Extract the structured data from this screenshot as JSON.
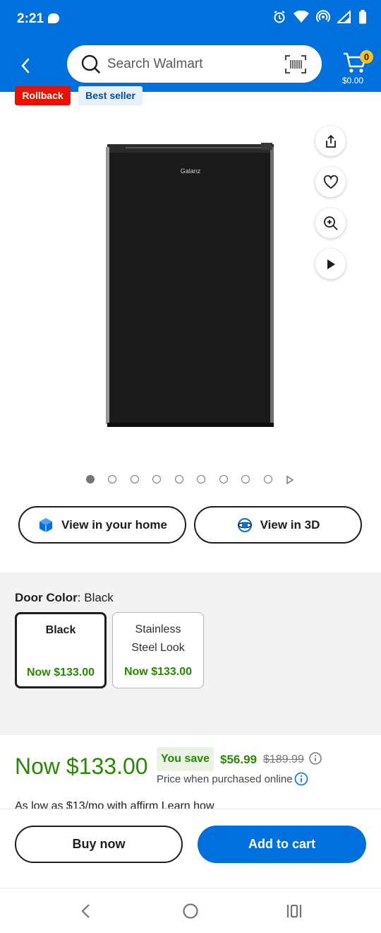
{
  "status_bar": {
    "time": "2:21"
  },
  "header": {
    "search_placeholder": "Search Walmart",
    "cart_count": "0",
    "cart_amount": "$0.00"
  },
  "badges": {
    "rollback": "Rollback",
    "best_seller": "Best seller"
  },
  "product": {
    "brand_mark": "Galanz"
  },
  "gallery": {
    "image_count": 9,
    "active_index": 0
  },
  "ar_buttons": {
    "view_home": "View in your home",
    "view_3d": "View in 3D"
  },
  "variants": {
    "label": "Door Color",
    "selected": "Black",
    "options": [
      {
        "name": "Black",
        "price": "Now $133.00"
      },
      {
        "name": "Stainless Steel Look",
        "price": "Now $133.00"
      }
    ]
  },
  "pricing": {
    "now": "Now $133.00",
    "you_save_label": "You save",
    "save_amount": "$56.99",
    "was_price": "$189.99",
    "note": "Price when purchased online",
    "affirm_line": "As low as $13/mo with affirm Learn how"
  },
  "actions": {
    "buy_now": "Buy now",
    "add_to_cart": "Add to cart"
  },
  "colors": {
    "brand_blue": "#0071dc",
    "price_green": "#2a8703",
    "rollback_red": "#ea1100",
    "cart_yellow": "#ffc220"
  }
}
